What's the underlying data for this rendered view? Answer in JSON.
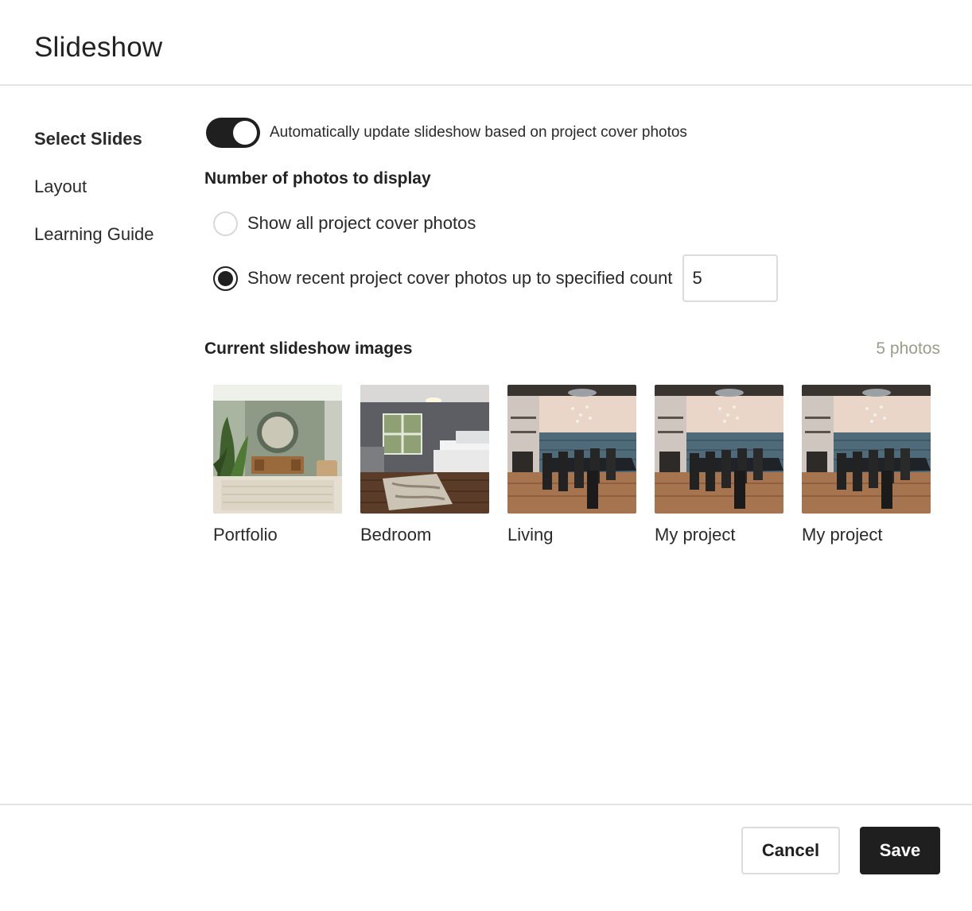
{
  "dialog": {
    "title": "Slideshow"
  },
  "sidebar": {
    "items": [
      {
        "label": "Select Slides",
        "active": true
      },
      {
        "label": "Layout",
        "active": false
      },
      {
        "label": "Learning Guide",
        "active": false
      }
    ]
  },
  "auto_update": {
    "enabled": true,
    "label": "Automatically update slideshow based on project cover photos"
  },
  "photo_count_section": {
    "title": "Number of photos to display",
    "options": [
      {
        "label": "Show all project cover photos",
        "selected": false
      },
      {
        "label": "Show recent project cover photos up to specified count",
        "selected": true
      }
    ],
    "count_value": "5"
  },
  "current_images": {
    "title": "Current slideshow images",
    "count_label": "5 photos",
    "items": [
      {
        "label": "Portfolio",
        "scene": "living-room-green"
      },
      {
        "label": "Bedroom",
        "scene": "bedroom"
      },
      {
        "label": "Living",
        "scene": "dining-ocean"
      },
      {
        "label": "My project",
        "scene": "dining-ocean"
      },
      {
        "label": "My project",
        "scene": "dining-ocean"
      }
    ]
  },
  "footer": {
    "cancel_label": "Cancel",
    "save_label": "Save"
  },
  "colors": {
    "primary": "#1f1f1f",
    "muted_text": "#9a9d8a",
    "border": "#e4e4e4"
  }
}
